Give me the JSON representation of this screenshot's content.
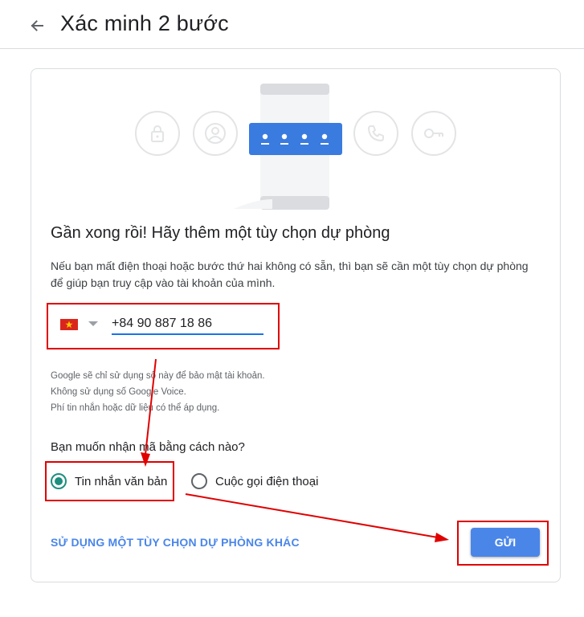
{
  "header": {
    "title": "Xác minh 2 bước",
    "back_icon": "arrow-left-icon"
  },
  "hero": {
    "icons": [
      "lock-icon",
      "account-icon",
      "phone-call-icon",
      "key-icon"
    ],
    "illustration": "phone-password-illustration",
    "accent_color": "#3a7be0"
  },
  "content": {
    "heading": "Gần xong rồi! Hãy thêm một tùy chọn dự phòng",
    "description": "Nếu bạn mất điện thoại hoặc bước thứ hai không có sẵn, thì bạn sẽ cần một tùy chọn dự phòng để giúp bạn truy cập vào tài khoản của mình.",
    "phone": {
      "country_flag": "vietnam-flag-icon",
      "value": "+84 90 887 18 86"
    },
    "notes": [
      "Google sẽ chỉ sử dụng số này để bảo mật tài khoản.",
      "Không sử dụng số Google Voice.",
      "Phí tin nhắn hoặc dữ liệu có thể áp dụng."
    ],
    "question": "Bạn muốn nhận mã bằng cách nào?",
    "options": [
      {
        "label": "Tin nhắn văn bản",
        "selected": true
      },
      {
        "label": "Cuộc gọi điện thoại",
        "selected": false
      }
    ],
    "alt_link": "SỬ DỤNG MỘT TÙY CHỌN DỰ PHÒNG KHÁC",
    "send_button": "GỬI"
  },
  "colors": {
    "primary": "#4a86e8",
    "radio_checked": "#1e8e7e",
    "annotation": "#e00000"
  }
}
